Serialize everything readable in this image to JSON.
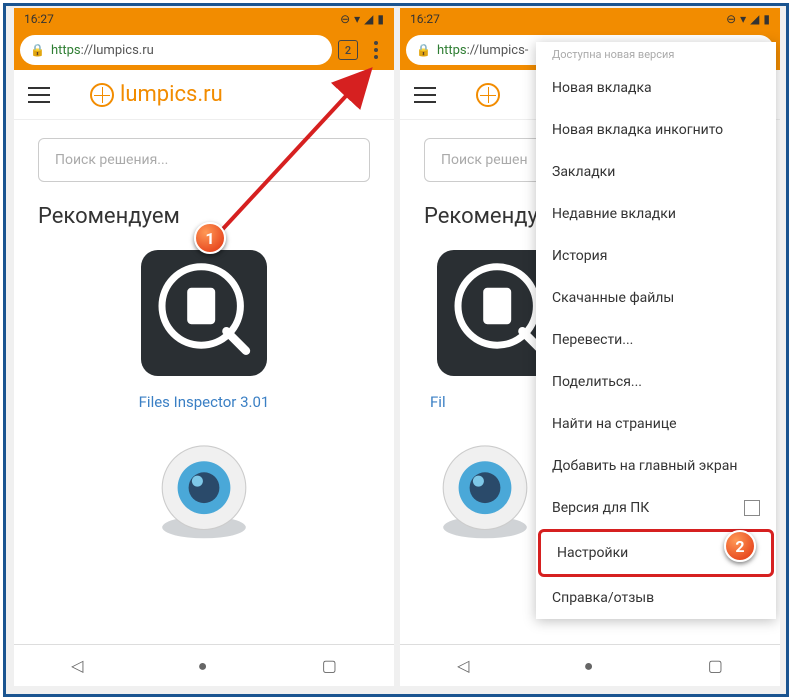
{
  "status": {
    "time": "16:27"
  },
  "url": {
    "https": "https",
    "rest": "://lumpics.ru",
    "tab_count": "2",
    "rest_short": "://lumpics-"
  },
  "site": {
    "brand": "lumpics.ru",
    "search_placeholder": "Поиск решения...",
    "recommend": "Рекомендуем",
    "app_title": "Files Inspector 3.01",
    "search_short": "Поиск решен"
  },
  "menu": {
    "header": "Доступна новая версия",
    "items": [
      "Новая вкладка",
      "Новая вкладка инкогнито",
      "Закладки",
      "Недавние вкладки",
      "История",
      "Скачанные файлы",
      "Перевести...",
      "Поделиться...",
      "Найти на странице",
      "Добавить на главный экран",
      "Версия для ПК",
      "Настройки",
      "Справка/отзыв"
    ]
  },
  "markers": {
    "m1": "1",
    "m2": "2"
  },
  "app_short": "Fil"
}
